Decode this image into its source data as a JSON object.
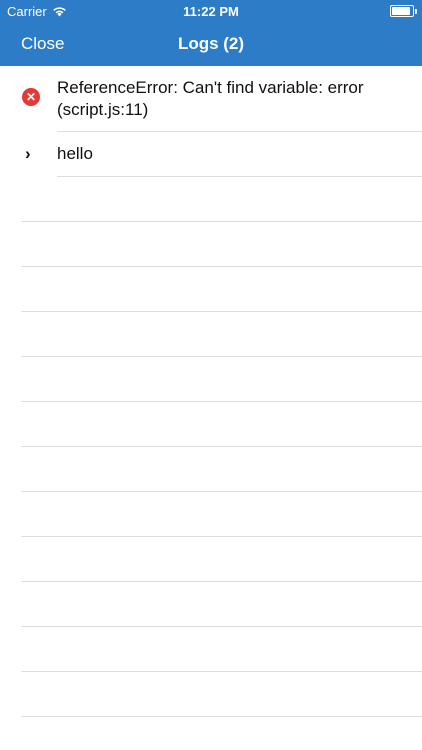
{
  "status_bar": {
    "carrier": "Carrier",
    "time": "11:22 PM",
    "battery_level": 0.9
  },
  "nav": {
    "close_label": "Close",
    "title": "Logs (2)"
  },
  "logs": [
    {
      "type": "error",
      "icon": "error-circle-icon",
      "message": "ReferenceError: Can't find variable: error (script.js:11)"
    },
    {
      "type": "log",
      "icon": "chevron-right-icon",
      "message": "hello"
    }
  ],
  "colors": {
    "nav_background": "#2d7cc7",
    "error": "#e53935",
    "separator": "#dedede"
  }
}
